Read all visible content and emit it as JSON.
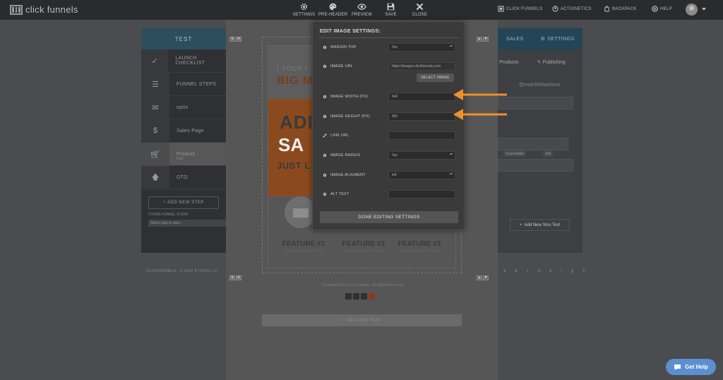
{
  "brand": {
    "name": "click funnels"
  },
  "toolbar": [
    {
      "label": "SETTINGS",
      "icon": "gear-icon"
    },
    {
      "label": "PRE-HEADER",
      "icon": "palette-icon"
    },
    {
      "label": "PREVIEW",
      "icon": "eye-icon"
    },
    {
      "label": "SAVE",
      "icon": "save-icon"
    },
    {
      "label": "CLOSE",
      "icon": "close-icon"
    }
  ],
  "topnav": [
    {
      "label": "CLICK FUNNELS",
      "icon": "funnel-icon"
    },
    {
      "label": "ACTIONETICS",
      "icon": "user-icon"
    },
    {
      "label": "BACKPACK",
      "icon": "backpack-icon"
    },
    {
      "label": "HELP",
      "icon": "help-icon"
    }
  ],
  "funnel": {
    "header": "TEST",
    "items": [
      {
        "label": "LAUNCH CHECKLIST",
        "icon": "checklist-icon"
      },
      {
        "label": "FUNNEL STEPS",
        "icon": "list-icon"
      },
      {
        "label": "optin",
        "icon": "envelope-icon"
      },
      {
        "label": "Sales Page",
        "icon": "dollar-icon"
      },
      {
        "label": "Product",
        "sub": "Cart",
        "icon": "cart-icon"
      },
      {
        "label": "OTO",
        "icon": "arrow-up-icon"
      }
    ],
    "add_step": "+ ADD NEW STEP",
    "other_steps": "OTHER FUNNEL STEPS",
    "select_placeholder": "Select step to view...",
    "footer": "CLICKFUNNELS   © 2016 ETISON LLC"
  },
  "right_panel": {
    "tab_sales": "SALES",
    "tab_settings": "SETTINGS",
    "subtab_products": "Products",
    "subtab_publishing": "Publishing",
    "handle": "@mobSMSactions",
    "chip_a": "Unavailable",
    "chip_b": "edit",
    "add_text": "Add New Sms Text",
    "pager": [
      "a",
      "b",
      "c",
      "d",
      "e",
      "f",
      "g",
      "h"
    ]
  },
  "page_preview": {
    "hero_top": "[ YOUR I",
    "hero_big": "BIG M",
    "hero_w1": "ADI",
    "hero_w2": "SA",
    "hero_w3": "JUST L",
    "features": [
      {
        "title": "FEATURE #1",
        "sub": "SUB HEADLINE TEXT"
      },
      {
        "title": "FEATURE #2",
        "sub": "SUB HEADLINE TEXT"
      },
      {
        "title": "FEATURE #3",
        "sub": "SUB HEADLINE TEXT"
      }
    ],
    "copyright": "Copyright 20xx Your Company - All Rights Reserved",
    "add_row": "+ ADD NEW ROW"
  },
  "image_settings": {
    "title": "EDIT IMAGE SETTINGS:",
    "margin_top": {
      "label": "MARGIN TOP",
      "value": "0px"
    },
    "image_url": {
      "label": "IMAGE URL",
      "value": "https://images.clickfunnels.com"
    },
    "select_image": "SELECT IMAGE",
    "image_width": {
      "label": "IMAGE WIDTH (PX)",
      "value": "540"
    },
    "image_height": {
      "label": "IMAGE HEIGHT (PX)",
      "value": "895"
    },
    "link_url": {
      "label": "LINK URL",
      "value": ""
    },
    "image_radius": {
      "label": "IMAGE RADIUS",
      "value": "0px"
    },
    "image_alignment": {
      "label": "IMAGE ALIGMENT",
      "value": "left"
    },
    "alt_text": {
      "label": "ALT TEXT",
      "value": ""
    },
    "done": "DONE EDITING SETTINGS"
  },
  "colors": {
    "arrow": "#f0902a",
    "help_button": "#5b8fcf",
    "funnel_header": "#2c4e5d"
  },
  "get_help": "Get Help"
}
